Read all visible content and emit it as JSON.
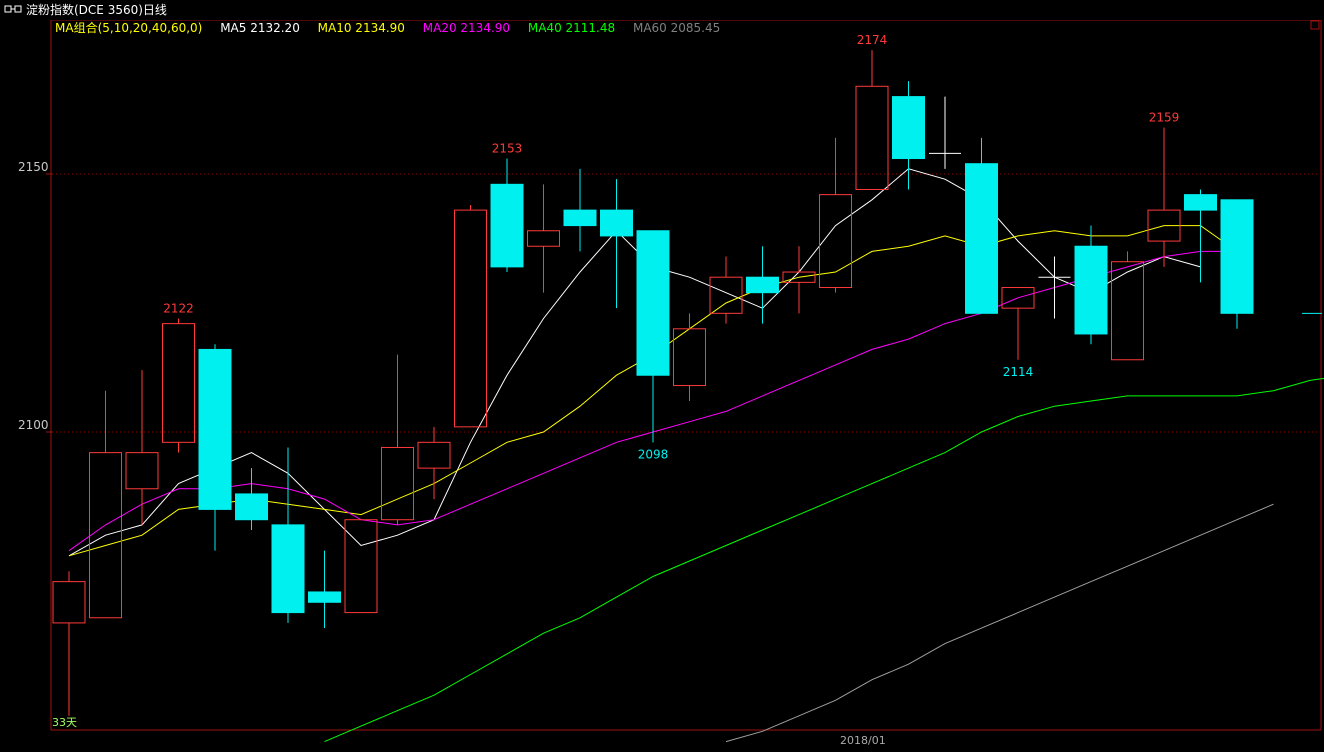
{
  "header": {
    "title": "淀粉指数(DCE 3560)日线"
  },
  "ma_legend": {
    "group_label": "MA组合(5,10,20,40,60,0)",
    "items": [
      {
        "label": "MA5 2132.20",
        "color": "#ffffff"
      },
      {
        "label": "MA10 2134.90",
        "color": "#ffff00"
      },
      {
        "label": "MA20 2134.90",
        "color": "#ff00ff"
      },
      {
        "label": "MA40 2111.48",
        "color": "#00ff00"
      },
      {
        "label": "MA60 2085.45",
        "color": "#808080"
      }
    ]
  },
  "footer": {
    "corner_text": "33天",
    "date_label": "2018/01"
  },
  "chart_data": {
    "type": "candlestick",
    "ylim": [
      2040,
      2152
    ],
    "y_ticks": [
      2100,
      2150
    ],
    "up_color": "#ff3a3a",
    "down_color": "#00f0f0",
    "candles": [
      {
        "open": 2063,
        "close": 2071,
        "high": 2073,
        "low": 2045
      },
      {
        "open": 2064,
        "close": 2096,
        "high": 2108,
        "low": 2064
      },
      {
        "open": 2089,
        "close": 2096,
        "high": 2112,
        "low": 2082
      },
      {
        "open": 2098,
        "close": 2121,
        "high": 2122,
        "low": 2096
      },
      {
        "open": 2116,
        "close": 2085,
        "high": 2117,
        "low": 2077
      },
      {
        "open": 2088,
        "close": 2083,
        "high": 2093,
        "low": 2081
      },
      {
        "open": 2082,
        "close": 2065,
        "high": 2097,
        "low": 2063
      },
      {
        "open": 2069,
        "close": 2067,
        "high": 2077,
        "low": 2062
      },
      {
        "open": 2065,
        "close": 2083,
        "high": 2083,
        "low": 2065
      },
      {
        "open": 2083,
        "close": 2097,
        "high": 2115,
        "low": 2082
      },
      {
        "open": 2093,
        "close": 2098,
        "high": 2101,
        "low": 2087
      },
      {
        "open": 2101,
        "close": 2143,
        "high": 2144,
        "low": 2101
      },
      {
        "open": 2148,
        "close": 2132,
        "high": 2153,
        "low": 2131
      },
      {
        "open": 2136,
        "close": 2139,
        "high": 2148,
        "low": 2127
      },
      {
        "open": 2143,
        "close": 2140,
        "high": 2151,
        "low": 2135
      },
      {
        "open": 2143,
        "close": 2138,
        "high": 2149,
        "low": 2124
      },
      {
        "open": 2139,
        "close": 2111,
        "high": 2139,
        "low": 2098
      },
      {
        "open": 2109,
        "close": 2120,
        "high": 2123,
        "low": 2106
      },
      {
        "open": 2123,
        "close": 2130,
        "high": 2134,
        "low": 2121
      },
      {
        "open": 2130,
        "close": 2127,
        "high": 2136,
        "low": 2121
      },
      {
        "open": 2129,
        "close": 2131,
        "high": 2136,
        "low": 2123
      },
      {
        "open": 2128,
        "close": 2146,
        "high": 2157,
        "low": 2127
      },
      {
        "open": 2147,
        "close": 2167,
        "high": 2174,
        "low": 2147
      },
      {
        "open": 2165,
        "close": 2153,
        "high": 2168,
        "low": 2147
      },
      {
        "open": 2154,
        "close": 2154,
        "high": 2165,
        "low": 2151
      },
      {
        "open": 2152,
        "close": 2123,
        "high": 2157,
        "low": 2123
      },
      {
        "open": 2124,
        "close": 2128,
        "high": 2128,
        "low": 2114
      },
      {
        "open": 2130,
        "close": 2130,
        "high": 2134,
        "low": 2122
      },
      {
        "open": 2136,
        "close": 2119,
        "high": 2140,
        "low": 2117
      },
      {
        "open": 2114,
        "close": 2133,
        "high": 2135,
        "low": 2114
      },
      {
        "open": 2137,
        "close": 2143,
        "high": 2159,
        "low": 2132
      },
      {
        "open": 2146,
        "close": 2143,
        "high": 2147,
        "low": 2129
      },
      {
        "open": 2145,
        "close": 2123,
        "high": 2145,
        "low": 2120
      }
    ],
    "ma_series": [
      {
        "name": "MA5",
        "color": "#ffffff",
        "values": [
          2076,
          2080,
          2082,
          2090,
          2093,
          2096,
          2092,
          2085,
          2078,
          2080,
          2083,
          2098,
          2111,
          2122,
          2131,
          2139,
          2132,
          2130,
          2127,
          2124,
          2131,
          2140,
          2145,
          2151,
          2149,
          2145,
          2137,
          2130,
          2127,
          2131,
          2134,
          2132
        ]
      },
      {
        "name": "MA10",
        "color": "#ffff00",
        "values": [
          2076,
          2078,
          2080,
          2085,
          2086,
          2087,
          2086,
          2085,
          2084,
          2087,
          2090,
          2094,
          2098,
          2100,
          2105,
          2111,
          2115,
          2120,
          2125,
          2128,
          2130,
          2131,
          2135,
          2136,
          2138,
          2136,
          2138,
          2139,
          2138,
          2138,
          2140,
          2140,
          2135
        ]
      },
      {
        "name": "MA20",
        "color": "#ff00ff",
        "values": [
          2077,
          2082,
          2086,
          2089,
          2089,
          2090,
          2089,
          2087,
          2083,
          2082,
          2083,
          2086,
          2089,
          2092,
          2095,
          2098,
          2100,
          2102,
          2104,
          2107,
          2110,
          2113,
          2116,
          2118,
          2121,
          2123,
          2126,
          2128,
          2130,
          2132,
          2134,
          2135,
          2135
        ]
      },
      {
        "name": "MA40",
        "color": "#00ff00",
        "start": 7,
        "values": [
          2040,
          2043,
          2046,
          2049,
          2053,
          2057,
          2061,
          2064,
          2068,
          2072,
          2075,
          2078,
          2081,
          2084,
          2087,
          2090,
          2093,
          2096,
          2100,
          2103,
          2105,
          2106,
          2107,
          2107,
          2107,
          2107,
          2108,
          2110,
          2111,
          2112
        ]
      },
      {
        "name": "MA60",
        "color": "#a0a0a0",
        "start": 18,
        "values": [
          2040,
          2042,
          2045,
          2048,
          2052,
          2055,
          2059,
          2062,
          2065,
          2068,
          2071,
          2074,
          2077,
          2080,
          2083,
          2086
        ]
      }
    ],
    "annotations": [
      {
        "candle": 3,
        "value": 2122,
        "label": "2122",
        "pos": "above",
        "color": "#ff3a3a"
      },
      {
        "candle": 12,
        "value": 2153,
        "label": "2153",
        "pos": "above",
        "color": "#ff3a3a"
      },
      {
        "candle": 16,
        "value": 2098,
        "label": "2098",
        "pos": "below",
        "color": "#00f0f0"
      },
      {
        "candle": 22,
        "value": 2174,
        "label": "2174",
        "pos": "above",
        "color": "#ff3a3a"
      },
      {
        "candle": 26,
        "value": 2114,
        "label": "2114",
        "pos": "below",
        "color": "#00f0f0"
      },
      {
        "candle": 30,
        "value": 2159,
        "label": "2159",
        "pos": "above",
        "color": "#ff3a3a"
      }
    ],
    "last_price_marker": 2123
  }
}
